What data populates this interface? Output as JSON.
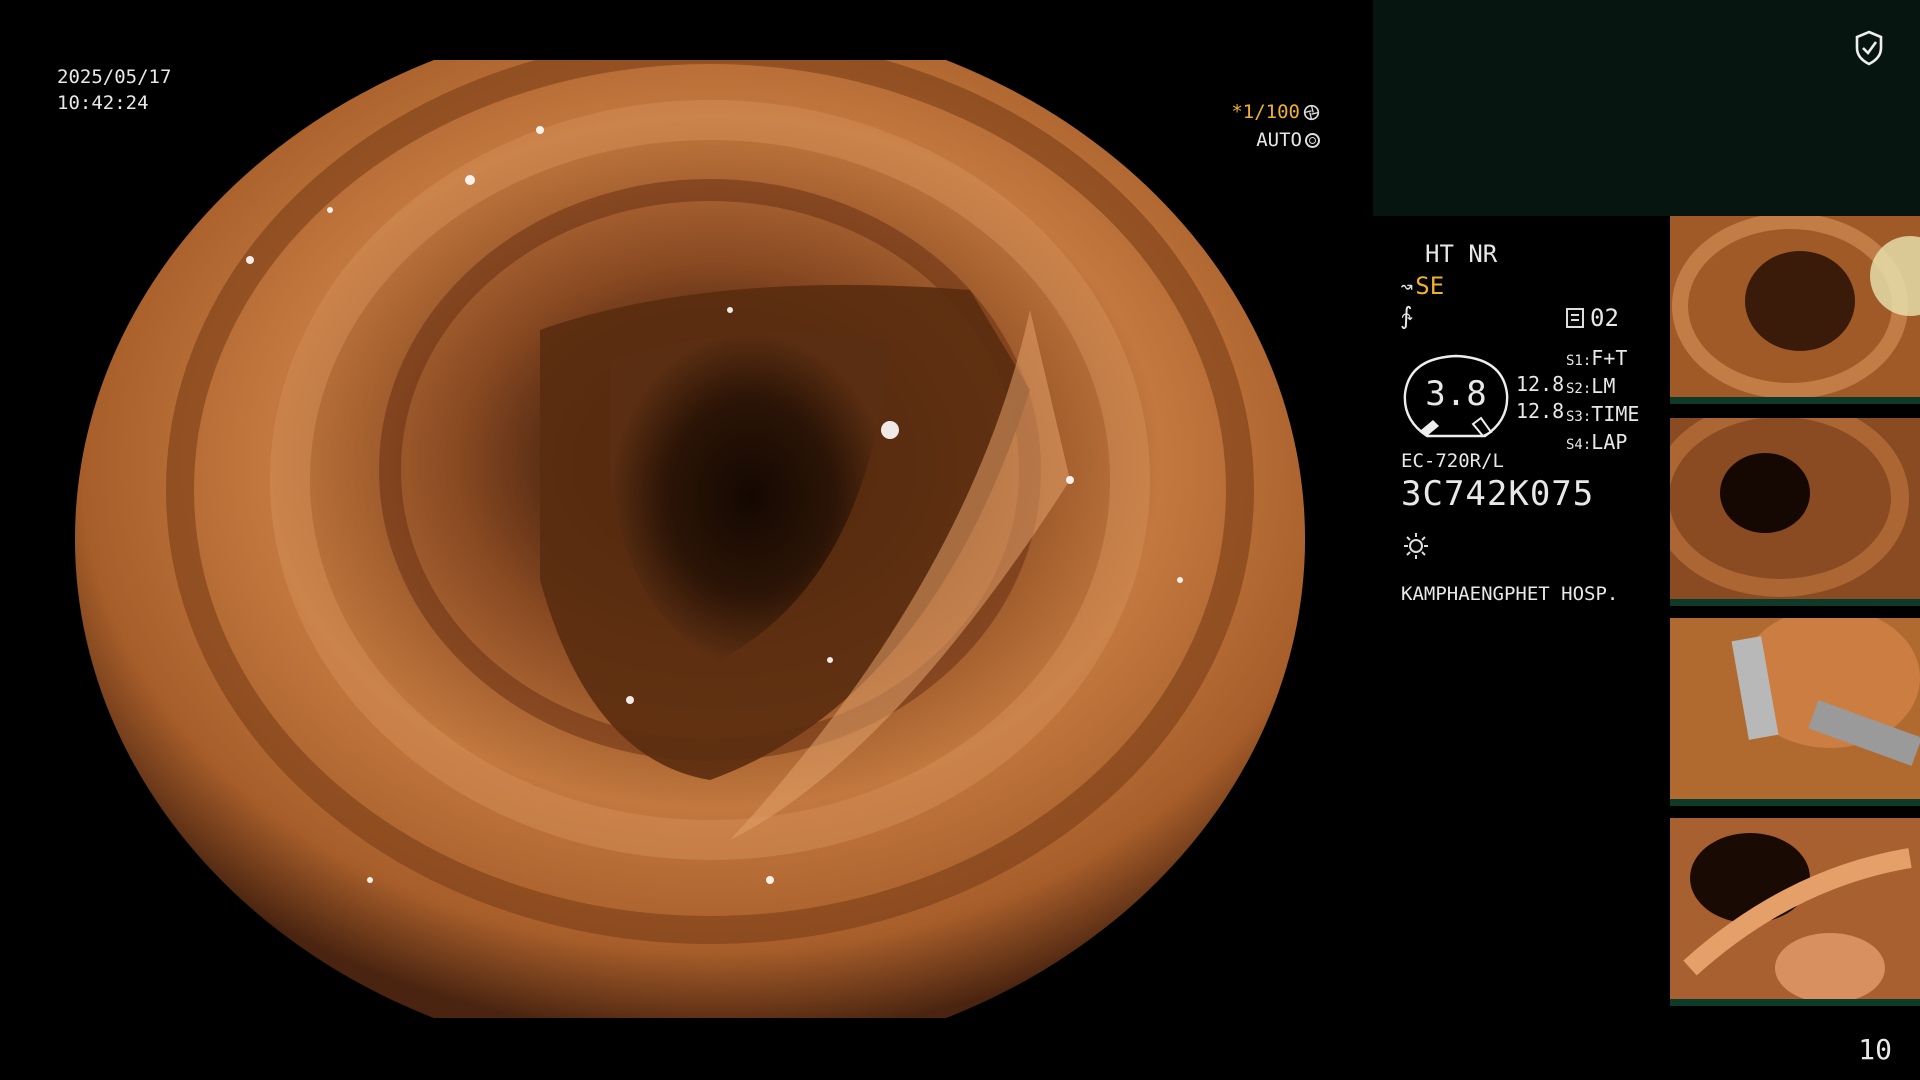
{
  "datetime": {
    "date": "2025/05/17",
    "time": "10:42:24"
  },
  "shutter": {
    "speed": "*1/100",
    "iris": "AUTO"
  },
  "settings": {
    "ht_nr": "HT NR",
    "enhance": "SE",
    "memory": "02"
  },
  "dial": {
    "value": "3.8",
    "level_top": "12.8",
    "level_bottom": "12.8"
  },
  "switches": [
    {
      "key": "S1:",
      "value": "F+T"
    },
    {
      "key": "S2:",
      "value": "LM"
    },
    {
      "key": "S3:",
      "value": "TIME"
    },
    {
      "key": "S4:",
      "value": "LAP"
    }
  ],
  "scope": {
    "model": "EC-720R/L",
    "serial": "3C742K075"
  },
  "hospital": "KAMPHAENGPHET HOSP.",
  "page_number": "10",
  "colors": {
    "accent_amber": "#f0b030",
    "thumb_bar": "#0e3a2a",
    "top_box": "#061510"
  },
  "icons": [
    "shield-check-icon",
    "aperture-icon",
    "iris-icon",
    "scope-mode-icon",
    "freeze-icon",
    "memory-icon",
    "light-icon"
  ]
}
